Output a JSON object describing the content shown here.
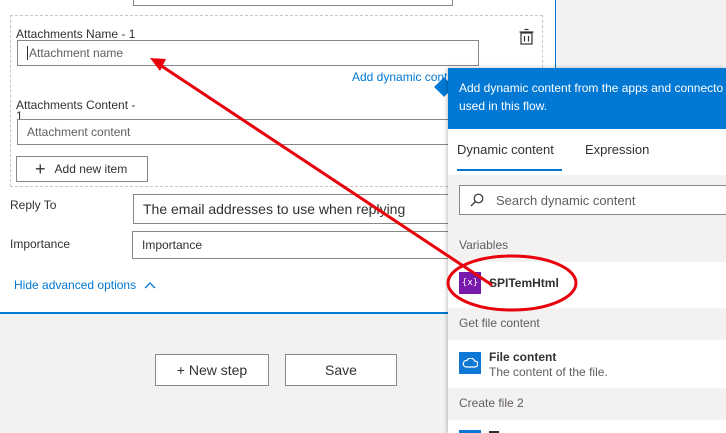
{
  "form": {
    "attachments_name_label": "Attachments Name - 1",
    "attachments_name_placeholder": "Attachment name",
    "add_dynamic_content_link": "Add dynamic cont",
    "attachments_content_label_line1": "Attachments Content -",
    "attachments_content_label_line2": "1",
    "attachments_content_placeholder": "Attachment content",
    "add_new_item_label": "Add new item",
    "reply_to_label": "Reply To",
    "reply_to_placeholder": "The email addresses to use when replying",
    "importance_label": "Importance",
    "importance_value": "Importance",
    "hide_advanced_label": "Hide advanced options"
  },
  "actions": {
    "new_step_label": "+ New step",
    "save_label": "Save"
  },
  "dynamic_panel": {
    "header_line1": "Add dynamic content from the apps and connecto",
    "header_line2": "used in this flow.",
    "tabs": [
      "Dynamic content",
      "Expression"
    ],
    "active_tab": "Dynamic content",
    "search_placeholder": "Search dynamic content",
    "sections": [
      {
        "title": "Variables",
        "items": [
          {
            "name": "SPITemHtml",
            "icon": "variable-icon",
            "icon_color": "#7719aa"
          }
        ]
      },
      {
        "title": "Get file content",
        "items": [
          {
            "name": "File content",
            "description": "The content of the file.",
            "icon": "onedrive-cloud-icon",
            "icon_color": "#0f78d4"
          }
        ]
      },
      {
        "title": "Create file 2",
        "items": []
      }
    ]
  },
  "annotation": {
    "color": "#e8000b"
  },
  "colors": {
    "accent": "#0078d4"
  }
}
